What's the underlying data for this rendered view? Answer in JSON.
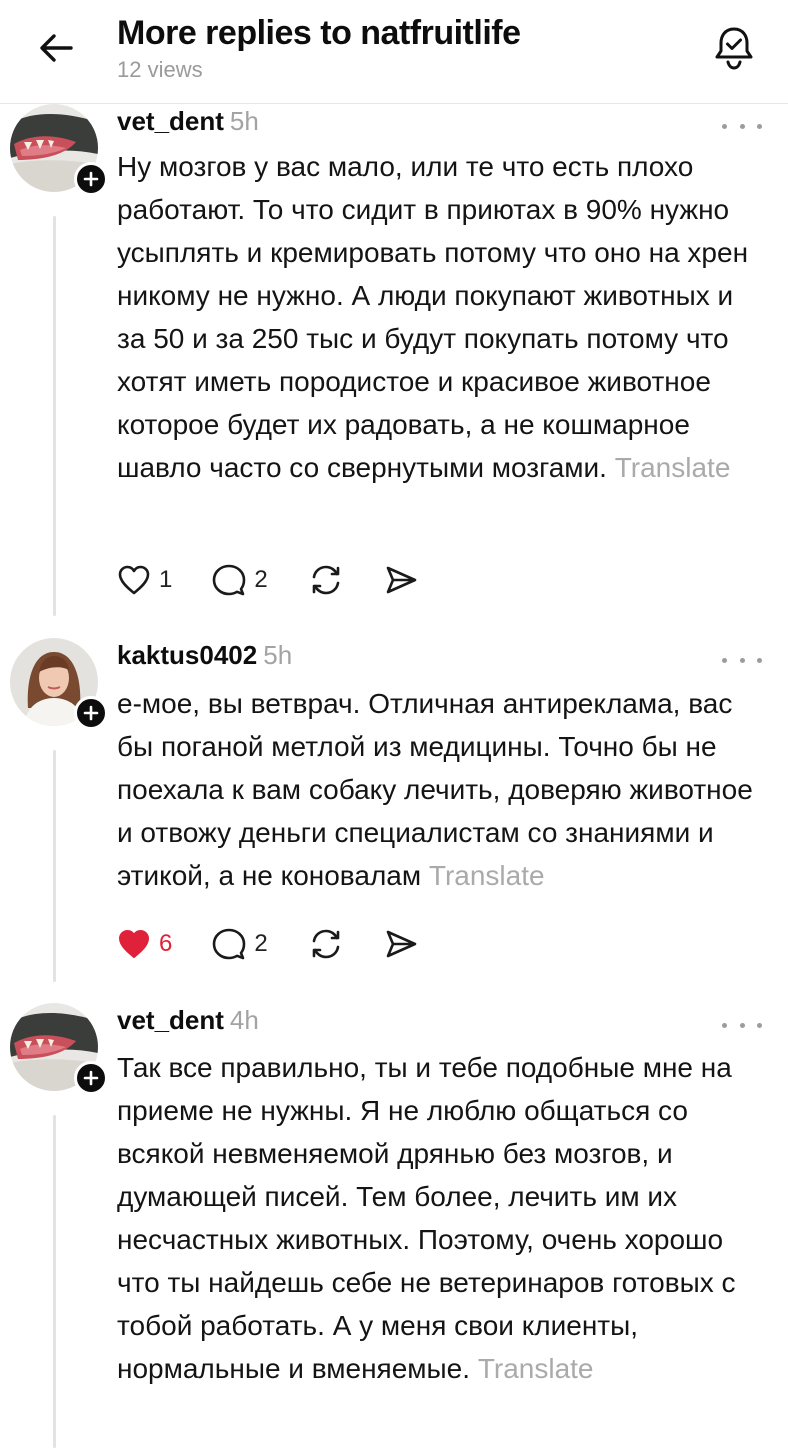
{
  "header": {
    "title": "More replies to natfruitlife",
    "views": "12 views",
    "back_icon": "back-arrow-icon",
    "bell_icon": "notification-bell-check-icon"
  },
  "posts": [
    {
      "username": "vet_dent",
      "time": "5h",
      "text": "Ну мозгов у вас мало, или те что есть плохо работают. То что сидит в приютах в 90% нужно усыплять и кремировать потому что оно на хрен никому не нужно. А люди покупают животных и за 50 и за 250 тыс и будут покупать потому что хотят иметь породистое и красивое животное которое будет их радовать, а не кошмарное шавло часто со свернутыми мозгами.",
      "translate": "Translate",
      "likes": "1",
      "replies": "2",
      "liked": false,
      "avatar": "dog-teeth-photo"
    },
    {
      "username": "kaktus0402",
      "time": "5h",
      "text": "е-мое, вы ветврач. Отличная антиреклама, вас бы поганой метлой из медицины. Точно бы не поехала к вам собаку лечить, доверяю животное и отвожу деньги специалистам со знаниями и этикой, а не коновалам",
      "translate": "Translate",
      "likes": "6",
      "replies": "2",
      "liked": true,
      "avatar": "woman-portrait-photo"
    },
    {
      "username": "vet_dent",
      "time": "4h",
      "text": "Так все правильно, ты и тебе подобные мне на приеме не нужны. Я не люблю общаться со всякой невменяемой дрянью без мозгов, и думающей писей. Тем более, лечить им их несчастных животных. Поэтому, очень хорошо что ты найдешь себе не ветеринаров готовых с тобой работать. А у меня свои клиенты, нормальные и вменяемые.",
      "translate": "Translate",
      "avatar": "dog-teeth-photo"
    }
  ],
  "colors": {
    "like_active": "#e0213a",
    "secondary_text": "#a3a3a3",
    "primary_text": "#141414"
  }
}
